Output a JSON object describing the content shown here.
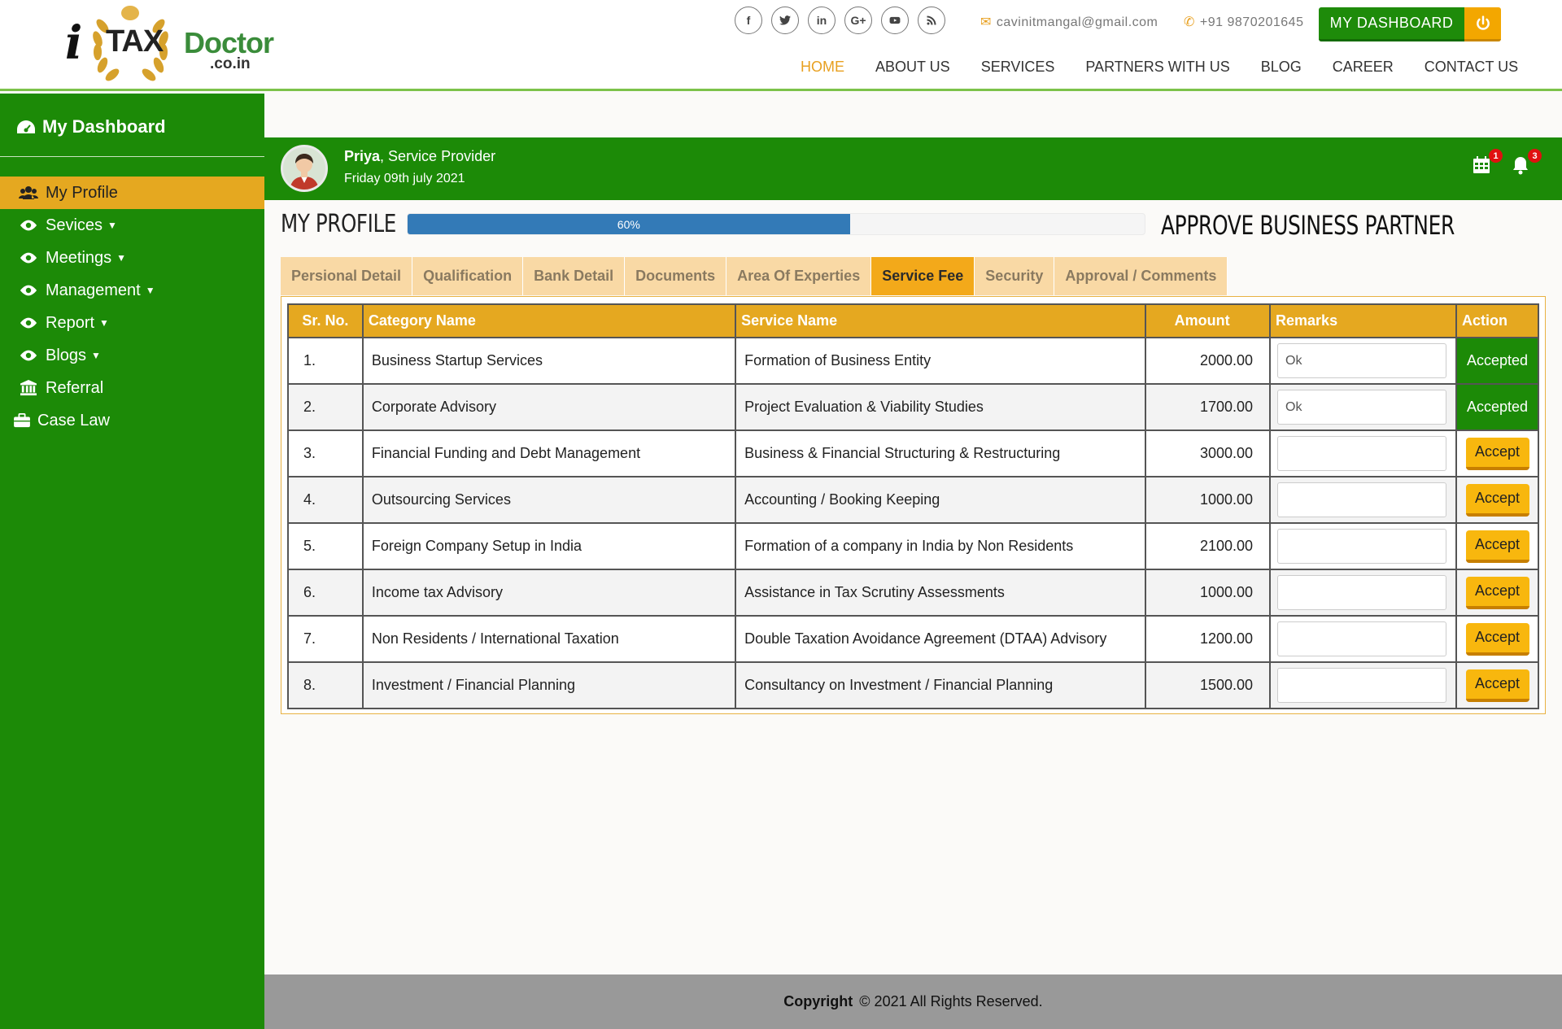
{
  "logo": {
    "i": "i",
    "tax": "TAX",
    "doctor": "Doctor",
    "domain": ".co.in"
  },
  "header": {
    "socials": [
      "f",
      "t",
      "in",
      "G+",
      "yt",
      "rss"
    ],
    "email": "cavinitmangal@gmail.com",
    "phone": "+91 9870201645",
    "dashboard_label": "MY DASHBOARD"
  },
  "nav": [
    "HOME",
    "ABOUT US",
    "SERVICES",
    "PARTNERS WITH US",
    "BLOG",
    "CAREER",
    "CONTACT US"
  ],
  "sidebar": {
    "title": "My Dashboard",
    "items": [
      {
        "label": "My Profile",
        "icon": "users-icon",
        "caret": false,
        "active": true
      },
      {
        "label": "Sevices",
        "icon": "eye-icon",
        "caret": true
      },
      {
        "label": "Meetings",
        "icon": "eye-icon",
        "caret": true
      },
      {
        "label": "Management",
        "icon": "eye-icon",
        "caret": true
      },
      {
        "label": "Report",
        "icon": "eye-icon",
        "caret": true
      },
      {
        "label": "Blogs",
        "icon": "eye-icon",
        "caret": true
      },
      {
        "label": "Referral",
        "icon": "bank-icon",
        "caret": false
      },
      {
        "label": "Case Law",
        "icon": "briefcase-icon",
        "caret": false
      }
    ]
  },
  "user": {
    "name": "Priya",
    "role": ", Service Provider",
    "date": "Friday 09th july 2021",
    "calendar_count": "1",
    "bell_count": "3"
  },
  "profile": {
    "title": "MY PROFILE",
    "progress_label": "60%",
    "progress_value": 60,
    "approve_title": "APPROVE BUSINESS PARTNER"
  },
  "tabs": [
    "Persional Detail",
    "Qualification",
    "Bank Detail",
    "Documents",
    "Area Of Experties",
    "Service Fee",
    "Security",
    "Approval / Comments"
  ],
  "active_tab": "Service Fee",
  "table": {
    "headers": [
      "Sr. No.",
      "Category Name",
      "Service Name",
      "Amount",
      "Remarks",
      "Action"
    ],
    "rows": [
      {
        "sr": "1.",
        "category": "Business Startup Services",
        "service": "Formation of Business Entity",
        "amount": "2000.00",
        "remarks": "Ok",
        "action": "Accepted"
      },
      {
        "sr": "2.",
        "category": "Corporate Advisory",
        "service": "Project Evaluation & Viability Studies",
        "amount": "1700.00",
        "remarks": "Ok",
        "action": "Accepted"
      },
      {
        "sr": "3.",
        "category": "Financial Funding and Debt Management",
        "service": "Business & Financial Structuring & Restructuring",
        "amount": "3000.00",
        "remarks": "",
        "action": "Accept"
      },
      {
        "sr": "4.",
        "category": "Outsourcing Services",
        "service": "Accounting / Booking Keeping",
        "amount": "1000.00",
        "remarks": "",
        "action": "Accept"
      },
      {
        "sr": "5.",
        "category": "Foreign Company Setup in India",
        "service": "Formation of a company in India by Non Residents",
        "amount": "2100.00",
        "remarks": "",
        "action": "Accept"
      },
      {
        "sr": "6.",
        "category": "Income tax Advisory",
        "service": "Assistance in Tax Scrutiny Assessments",
        "amount": "1000.00",
        "remarks": "",
        "action": "Accept"
      },
      {
        "sr": "7.",
        "category": "Non Residents / International Taxation",
        "service": "Double Taxation Avoidance Agreement (DTAA) Advisory",
        "amount": "1200.00",
        "remarks": "",
        "action": "Accept"
      },
      {
        "sr": "8.",
        "category": "Investment / Financial Planning",
        "service": "Consultancy on Investment / Financial Planning",
        "amount": "1500.00",
        "remarks": "",
        "action": "Accept"
      }
    ]
  },
  "footer": {
    "bold": "Copyright",
    "text": "© 2021 All Rights Reserved."
  },
  "colors": {
    "green": "#1c8a07",
    "amber": "#e5a820",
    "progress": "#337ab7"
  }
}
